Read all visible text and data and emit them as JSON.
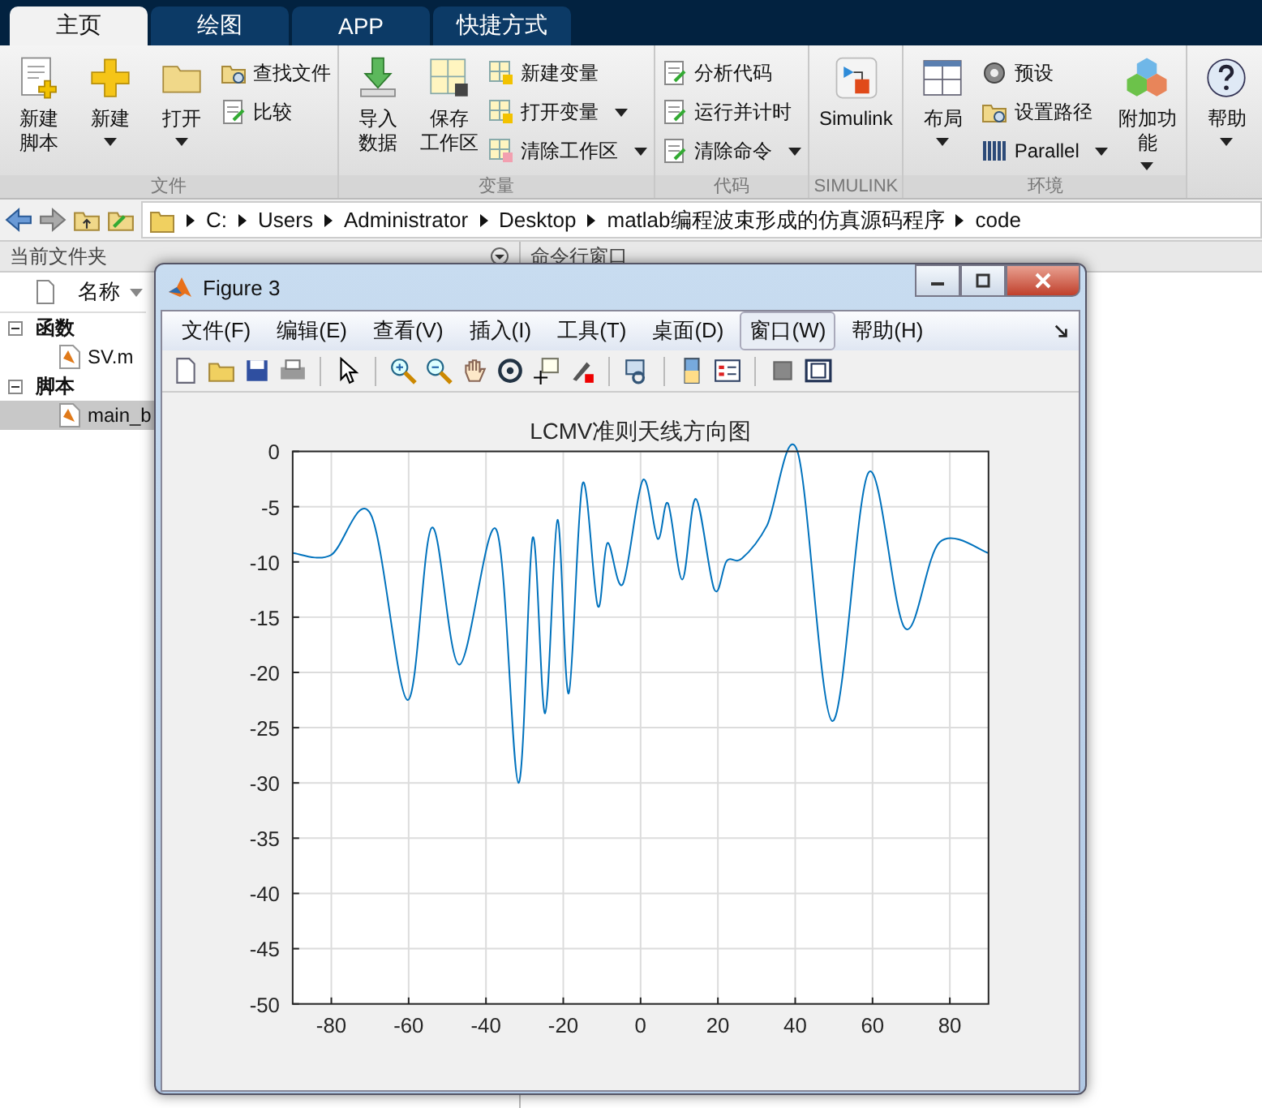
{
  "tabs": [
    {
      "label": "主页",
      "selected": true
    },
    {
      "label": "绘图",
      "selected": false
    },
    {
      "label": "APP",
      "selected": false
    },
    {
      "label": "快捷方式",
      "selected": false
    }
  ],
  "ribbon": {
    "groups": [
      {
        "label": "文件",
        "items": [
          {
            "kind": "large",
            "label": [
              "新建",
              "脚本"
            ],
            "dropdown": false
          },
          {
            "kind": "large",
            "label": [
              "新建"
            ],
            "dropdown": true
          },
          {
            "kind": "large",
            "label": [
              "打开"
            ],
            "dropdown": true
          },
          {
            "kind": "stack",
            "items": [
              {
                "label": "查找文件",
                "dropdown": false
              },
              {
                "label": "比较",
                "dropdown": false
              }
            ]
          }
        ]
      },
      {
        "label": "变量",
        "items": [
          {
            "kind": "large",
            "label": [
              "导入",
              "数据"
            ],
            "dropdown": false
          },
          {
            "kind": "large",
            "label": [
              "保存",
              "工作区"
            ],
            "dropdown": false
          },
          {
            "kind": "stack",
            "items": [
              {
                "label": "新建变量",
                "dropdown": false
              },
              {
                "label": "打开变量",
                "dropdown": true
              },
              {
                "label": "清除工作区",
                "dropdown": true
              }
            ]
          }
        ]
      },
      {
        "label": "代码",
        "items": [
          {
            "kind": "stack",
            "items": [
              {
                "label": "分析代码",
                "dropdown": false
              },
              {
                "label": "运行并计时",
                "dropdown": false
              },
              {
                "label": "清除命令",
                "dropdown": true
              }
            ]
          }
        ]
      },
      {
        "label": "SIMULINK",
        "items": [
          {
            "kind": "large",
            "label": [
              "Simulink"
            ],
            "dropdown": false
          }
        ]
      },
      {
        "label": "环境",
        "items": [
          {
            "kind": "large",
            "label": [
              "布局"
            ],
            "dropdown": true
          },
          {
            "kind": "stack",
            "items": [
              {
                "label": "预设",
                "dropdown": false
              },
              {
                "label": "设置路径",
                "dropdown": false
              },
              {
                "label": "Parallel",
                "dropdown": true
              }
            ]
          },
          {
            "kind": "large",
            "label": [
              "附加功能"
            ],
            "dropdown": true
          }
        ]
      },
      {
        "items": [
          {
            "kind": "large",
            "label": [
              "帮助"
            ],
            "dropdown": true
          }
        ]
      }
    ]
  },
  "address": {
    "segments": [
      "C:",
      "Users",
      "Administrator",
      "Desktop",
      "matlab编程波束形成的仿真源码程序",
      "code"
    ]
  },
  "file_panel": {
    "title": "当前文件夹",
    "column": "名称",
    "tree": [
      {
        "label": "函数",
        "expanded": true,
        "children": [
          {
            "label": "SV.m",
            "selected": false
          }
        ]
      },
      {
        "label": "脚本",
        "expanded": true,
        "children": [
          {
            "label": "main_b",
            "selected": true
          }
        ]
      }
    ]
  },
  "command_panel": {
    "title": "命令行窗口"
  },
  "figure": {
    "title": "Figure 3",
    "menu": [
      {
        "label": "文件(F)",
        "highlighted": false
      },
      {
        "label": "编辑(E)",
        "highlighted": false
      },
      {
        "label": "查看(V)",
        "highlighted": false
      },
      {
        "label": "插入(I)",
        "highlighted": false
      },
      {
        "label": "工具(T)",
        "highlighted": false
      },
      {
        "label": "桌面(D)",
        "highlighted": false
      },
      {
        "label": "窗口(W)",
        "highlighted": true
      },
      {
        "label": "帮助(H)",
        "highlighted": false
      }
    ],
    "chart_data": {
      "type": "line",
      "title": "LCMV准则天线方向图",
      "x": [
        -90,
        -80.2,
        -69.8,
        -60.3,
        -54,
        -46.9,
        -37.3,
        -31.6,
        -27.9,
        -24.7,
        -21.5,
        -18.6,
        -15,
        -11.1,
        -8.6,
        -4.6,
        0.6,
        4.4,
        7.1,
        10.8,
        14.3,
        19.1,
        22.3,
        26.2,
        32.7,
        40.6,
        49.6,
        59,
        68.4,
        77.4,
        90
      ],
      "series": [
        {
          "color": "#0072bd",
          "values": [
            -9.2,
            -9.4,
            -5.7,
            -22.5,
            -6.9,
            -19.3,
            -7.1,
            -30,
            -7.8,
            -23.7,
            -6.2,
            -21.9,
            -2.9,
            -14,
            -8.3,
            -12,
            -2.6,
            -7.9,
            -4.7,
            -11.6,
            -4.3,
            -12.5,
            -9.9,
            -9.7,
            -6.7,
            0,
            -24.4,
            -1.9,
            -16,
            -8.2,
            -9.2
          ]
        }
      ],
      "xlim": [
        -90,
        90
      ],
      "ylim": [
        -50,
        0
      ],
      "grid": true,
      "xticks": [
        -80,
        -60,
        -40,
        -20,
        0,
        20,
        40,
        60,
        80
      ],
      "yticks": [
        0,
        -5,
        -10,
        -15,
        -20,
        -25,
        -30,
        -35,
        -40,
        -45,
        -50
      ]
    }
  }
}
